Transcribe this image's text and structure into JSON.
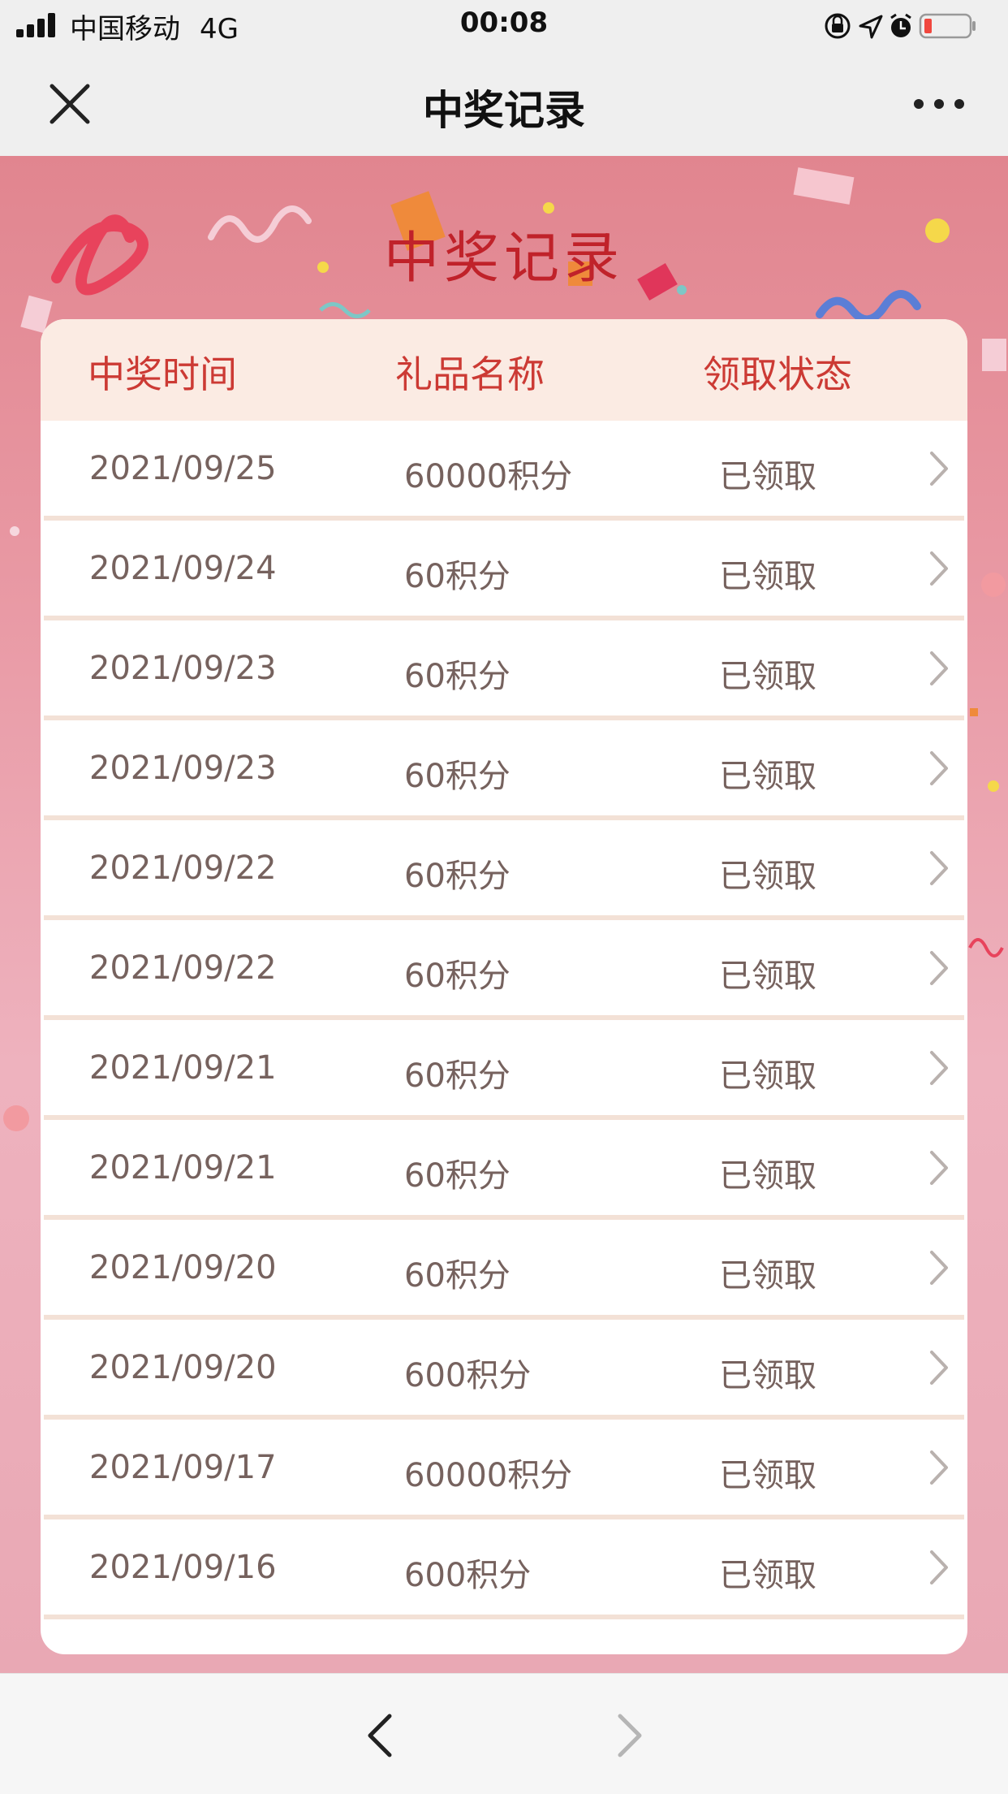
{
  "status_bar": {
    "carrier": "中国移动",
    "network": "4G",
    "time": "00:08",
    "icons": [
      "signal-icon",
      "rotation-lock-icon",
      "location-icon",
      "alarm-icon",
      "battery-low-icon"
    ],
    "battery_color": "#f0473e"
  },
  "nav": {
    "title": "中奖记录",
    "close_icon": "close-icon",
    "more_icon": "more-icon"
  },
  "banner": {
    "title": "中奖记录",
    "title_color": "#c0222a"
  },
  "table": {
    "headers": [
      "中奖时间",
      "礼品名称",
      "领取状态"
    ],
    "header_color": "#cc3a34",
    "rows": [
      {
        "date": "2021/09/25",
        "gift": "60000积分",
        "status": "已领取"
      },
      {
        "date": "2021/09/24",
        "gift": "60积分",
        "status": "已领取"
      },
      {
        "date": "2021/09/23",
        "gift": "60积分",
        "status": "已领取"
      },
      {
        "date": "2021/09/23",
        "gift": "60积分",
        "status": "已领取"
      },
      {
        "date": "2021/09/22",
        "gift": "60积分",
        "status": "已领取"
      },
      {
        "date": "2021/09/22",
        "gift": "60积分",
        "status": "已领取"
      },
      {
        "date": "2021/09/21",
        "gift": "60积分",
        "status": "已领取"
      },
      {
        "date": "2021/09/21",
        "gift": "60积分",
        "status": "已领取"
      },
      {
        "date": "2021/09/20",
        "gift": "60积分",
        "status": "已领取"
      },
      {
        "date": "2021/09/20",
        "gift": "600积分",
        "status": "已领取"
      },
      {
        "date": "2021/09/17",
        "gift": "60000积分",
        "status": "已领取"
      },
      {
        "date": "2021/09/16",
        "gift": "600积分",
        "status": "已领取"
      }
    ]
  },
  "toolbar": {
    "back_icon": "chevron-left-icon",
    "forward_icon": "chevron-right-icon"
  }
}
